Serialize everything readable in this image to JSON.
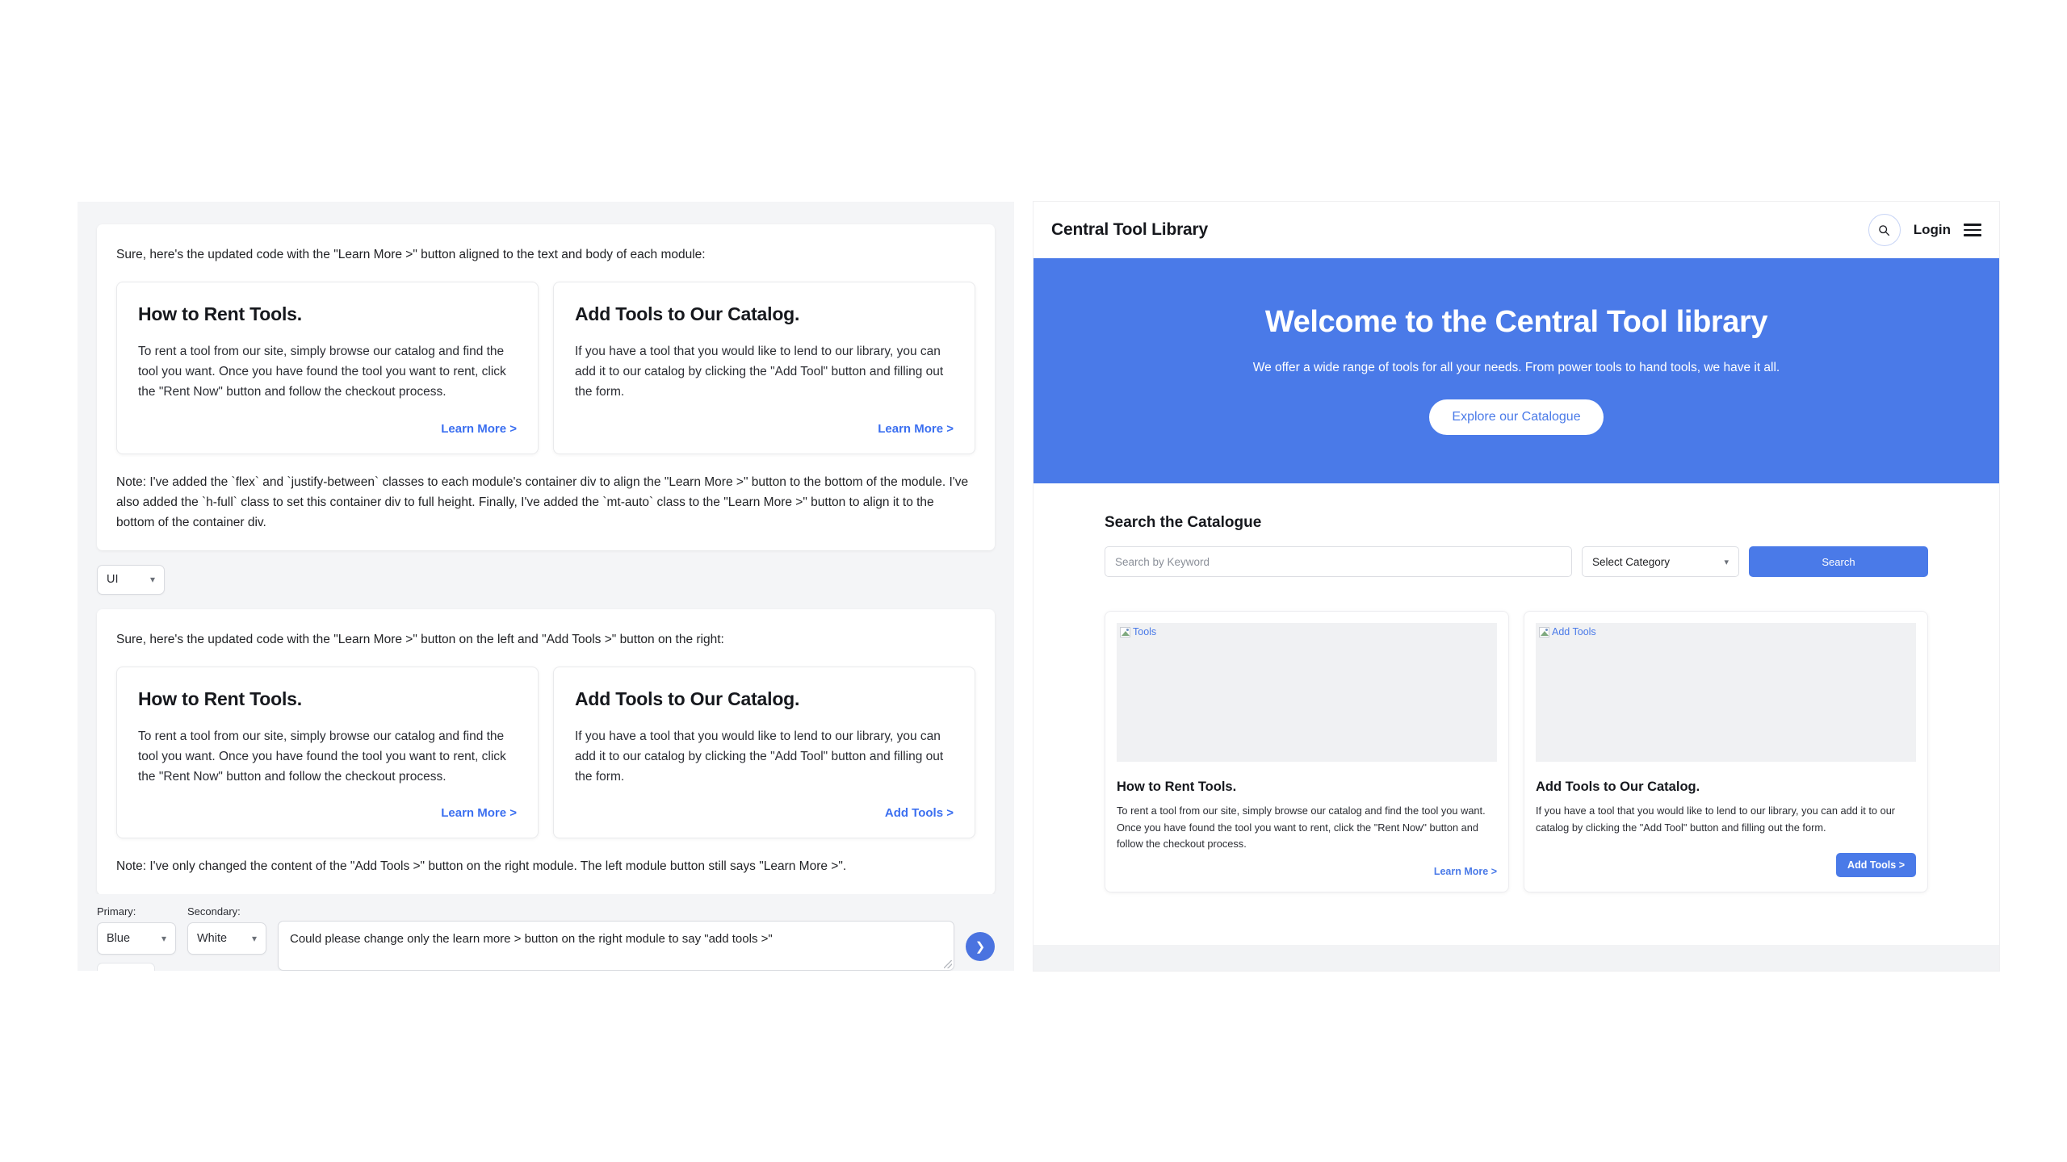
{
  "left_panel": {
    "message_1": {
      "intro": "Sure, here's the updated code with the \"Learn More >\" button aligned to the text and body of each module:",
      "modules": [
        {
          "title": "How to Rent Tools.",
          "body": "To rent a tool from our site, simply browse our catalog and find the tool you want. Once you have found the tool you want to rent, click the \"Rent Now\" button and follow the checkout process.",
          "link": "Learn More >"
        },
        {
          "title": "Add Tools to Our Catalog.",
          "body": "If you have a tool that you would like to lend to our library, you can add it to our catalog by clicking the \"Add Tool\" button and filling out the form.",
          "link": "Learn More >"
        }
      ],
      "note": "Note: I've added the `flex` and `justify-between` classes to each module's container div to align the \"Learn More >\" button to the bottom of the module. I've also added the `h-full` class to set this container div to full height. Finally, I've added the `mt-auto` class to the \"Learn More >\" button to align it to the bottom of the container div."
    },
    "ui_selector": {
      "value": "UI",
      "chevron": "chevron-down-icon"
    },
    "message_2": {
      "intro": "Sure, here's the updated code with the \"Learn More >\" button on the left and \"Add Tools >\" button on the right:",
      "modules": [
        {
          "title": "How to Rent Tools.",
          "body": "To rent a tool from our site, simply browse our catalog and find the tool you want. Once you have found the tool you want to rent, click the \"Rent Now\" button and follow the checkout process.",
          "link": "Learn More >"
        },
        {
          "title": "Add Tools to Our Catalog.",
          "body": "If you have a tool that you would like to lend to our library, you can add it to our catalog by clicking the \"Add Tool\" button and filling out the form.",
          "link": "Add Tools >"
        }
      ],
      "note": "Note: I've only changed the content of the \"Add Tools >\" button on the right module. The left module button still says \"Learn More >\"."
    },
    "composer": {
      "primary_label": "Primary:",
      "primary_value": "Blue",
      "secondary_label": "Secondary:",
      "secondary_value": "White",
      "prompt_value": "Could please change only the learn more > button on the right module to say \"add tools >\"",
      "prompt_placeholder": "",
      "send_icon": "chevron-right-icon",
      "overflow_label": "..."
    }
  },
  "right_panel": {
    "header": {
      "brand": "Central Tool Library",
      "search_icon": "search-icon",
      "login_label": "Login",
      "menu_icon": "hamburger-menu-icon"
    },
    "hero": {
      "title": "Welcome to the Central Tool library",
      "subtitle": "We offer a wide range of tools for all your needs. From power tools to hand tools, we have it all.",
      "cta_label": "Explore our Catalogue",
      "background_color": "#4a7ae8"
    },
    "catalogue": {
      "title": "Search the Catalogue",
      "keyword_placeholder": "Search by Keyword",
      "keyword_value": "",
      "category_value": "Select Category",
      "category_chevron": "chevron-down-icon",
      "search_button": "Search"
    },
    "cards": [
      {
        "image_alt": "Tools",
        "image_state": "broken-image-icon",
        "title": "How to Rent Tools.",
        "body": "To rent a tool from our site, simply browse our catalog and find the tool you want. Once you have found the tool you want to rent, click the \"Rent Now\" button and follow the checkout process.",
        "action_label": "Learn More >",
        "action_style": "link"
      },
      {
        "image_alt": "Add Tools",
        "image_state": "broken-image-icon",
        "title": "Add Tools to Our Catalog.",
        "body": "If you have a tool that you would like to lend to our library, you can add it to our catalog by clicking the \"Add Tool\" button and filling out the form.",
        "action_label": "Add Tools >",
        "action_style": "button"
      }
    ]
  },
  "colors": {
    "accent_blue": "#4a7ae8",
    "link_blue": "#3b6ff0",
    "panel_gray": "#f4f5f7",
    "footer_gray": "#f2f3f5"
  }
}
